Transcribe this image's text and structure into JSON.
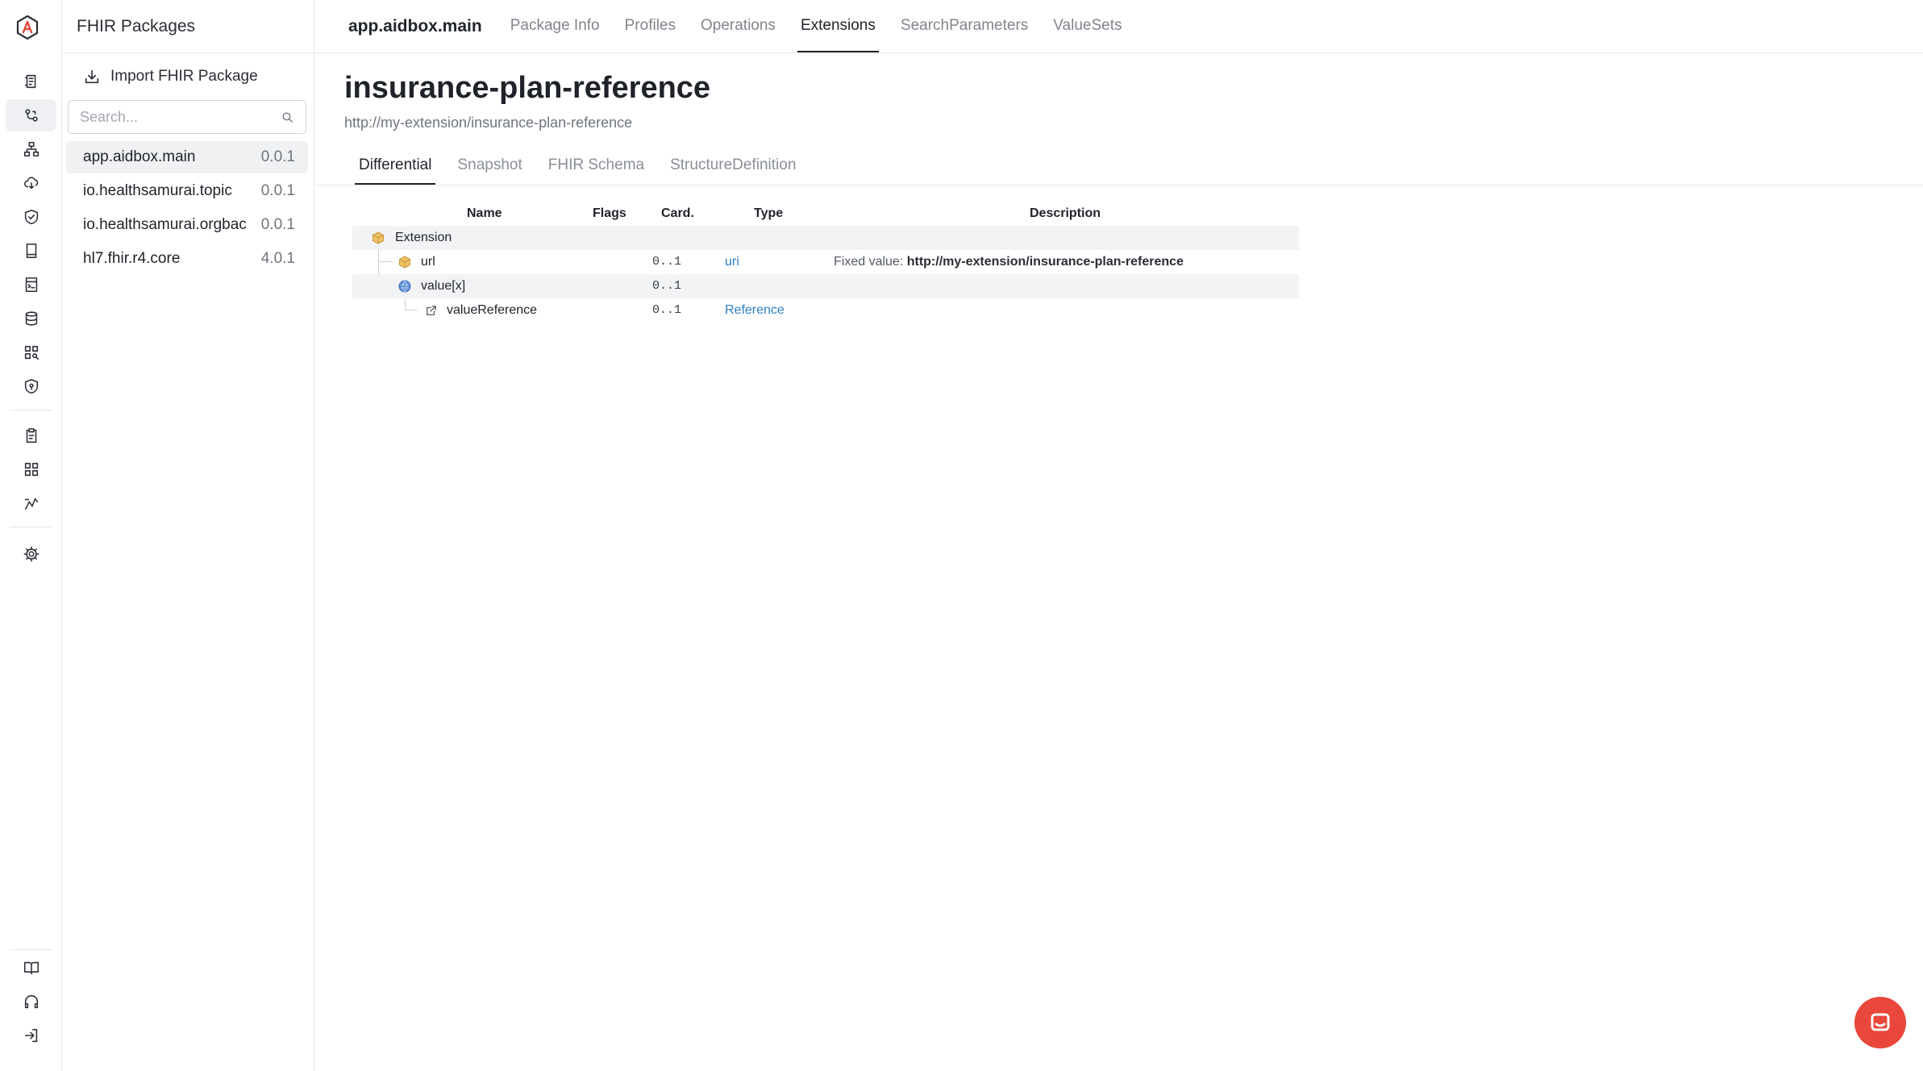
{
  "sidebar": {
    "title": "FHIR Packages",
    "import_label": "Import FHIR Package",
    "search_placeholder": "Search...",
    "packages": [
      {
        "name": "app.aidbox.main",
        "version": "0.0.1",
        "active": true
      },
      {
        "name": "io.healthsamurai.topic",
        "version": "0.0.1"
      },
      {
        "name": "io.healthsamurai.orgbac",
        "version": "0.0.1"
      },
      {
        "name": "hl7.fhir.r4.core",
        "version": "4.0.1"
      }
    ]
  },
  "topnav": {
    "package": "app.aidbox.main",
    "tabs": [
      "Package Info",
      "Profiles",
      "Operations",
      "Extensions",
      "SearchParameters",
      "ValueSets"
    ],
    "active_tab": "Extensions"
  },
  "extension": {
    "name": "insurance-plan-reference",
    "url": "http://my-extension/insurance-plan-reference"
  },
  "subtabs": {
    "items": [
      "Differential",
      "Snapshot",
      "FHIR Schema",
      "StructureDefinition"
    ],
    "active": "Differential"
  },
  "table": {
    "headers": {
      "name": "Name",
      "flags": "Flags",
      "card": "Card.",
      "type": "Type",
      "desc": "Description"
    },
    "rows": [
      {
        "name": "Extension",
        "flags": "",
        "card": "",
        "type": "",
        "desc_key": "",
        "desc_value": ""
      },
      {
        "name": "url",
        "flags": "",
        "card": "0..1",
        "type": "uri",
        "desc_key": "Fixed value: ",
        "desc_value": "http://my-extension/insurance-plan-reference"
      },
      {
        "name": "value[x]",
        "flags": "",
        "card": "0..1",
        "type": "",
        "desc_key": "",
        "desc_value": ""
      },
      {
        "name": "valueReference",
        "flags": "",
        "card": "0..1",
        "type": "Reference",
        "desc_key": "",
        "desc_value": ""
      }
    ]
  },
  "colors": {
    "accent_link": "#2b7fc4",
    "chat_button": "#e9473b",
    "element_cube": "#f0c36a",
    "choice_globe": "#5b8fd6"
  },
  "icons": [
    "aidbox-logo-icon",
    "resources-icon",
    "packages-icon",
    "hierarchy-icon",
    "cloud-sync-icon",
    "shield-check-icon",
    "notebook-icon",
    "terminal-notebook-icon",
    "database-icon",
    "apps-search-icon",
    "security-shield-icon",
    "clipboard-icon",
    "grid-icon",
    "activity-icon",
    "settings-icon",
    "docs-book-icon",
    "support-headphones-icon",
    "logout-icon",
    "chat-icon"
  ]
}
